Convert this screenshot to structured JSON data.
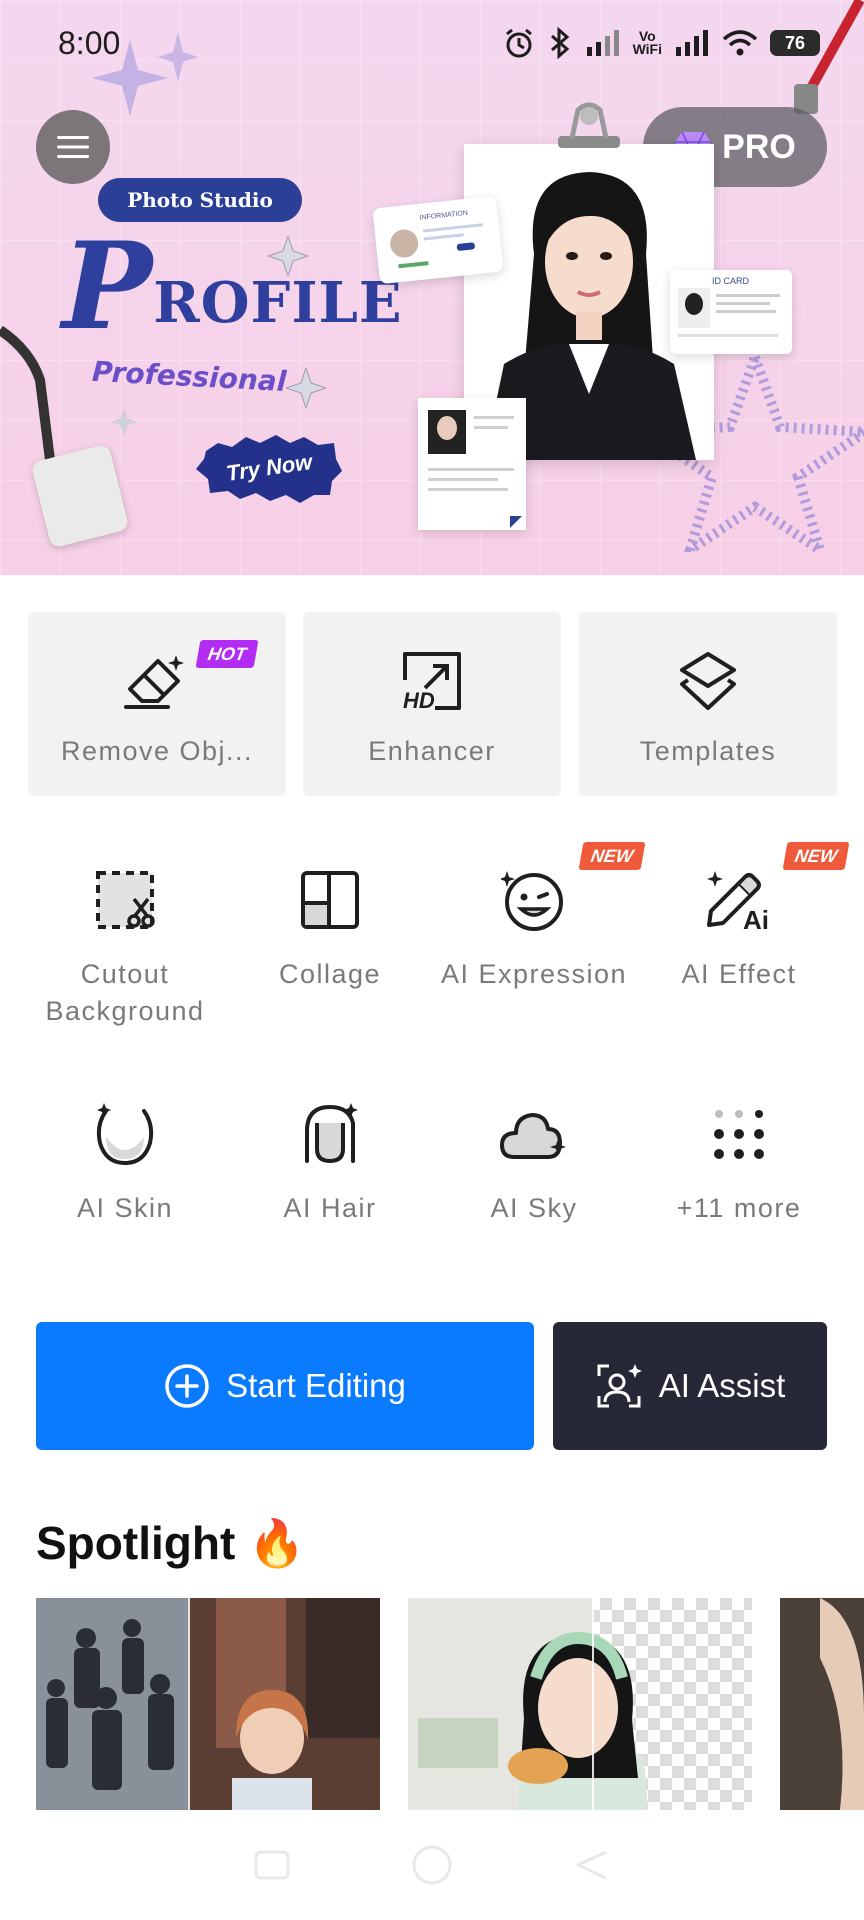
{
  "status_bar": {
    "time": "8:00",
    "vowifi_line1": "Vo",
    "vowifi_line2": "WiFi",
    "battery": "76"
  },
  "header": {
    "pro_label": "PRO"
  },
  "banner": {
    "photo_studio": "Photo Studio",
    "title_initial": "P",
    "title_rest": "ROFILE",
    "subtitle": "Professional",
    "cta": "Try Now",
    "info_card_text": "INFORMATION",
    "id_card_text": "ID CARD"
  },
  "quick_tools": [
    {
      "label": "Remove Obj...",
      "icon": "eraser-icon",
      "tag": "HOT"
    },
    {
      "label": "Enhancer",
      "icon": "hd-icon"
    },
    {
      "label": "Templates",
      "icon": "layers-icon"
    }
  ],
  "tools_grid": [
    {
      "label": "Cutout Background",
      "icon": "cutout-icon"
    },
    {
      "label": "Collage",
      "icon": "collage-icon"
    },
    {
      "label": "AI Expression",
      "icon": "wink-face-icon",
      "tag": "NEW"
    },
    {
      "label": "AI Effect",
      "icon": "magic-pen-icon",
      "tag": "NEW"
    },
    {
      "label": "AI Skin",
      "icon": "face-skin-icon"
    },
    {
      "label": "AI Hair",
      "icon": "hair-icon"
    },
    {
      "label": "AI Sky",
      "icon": "cloud-icon"
    },
    {
      "label": "+11 more",
      "icon": "grid-dots-icon"
    }
  ],
  "actions": {
    "start_editing": "Start Editing",
    "ai_assist": "AI Assist"
  },
  "spotlight": {
    "title": "Spotlight 🔥"
  },
  "colors": {
    "primary": "#0a7bff",
    "dark_button": "#262838",
    "hot_tag": "#b32cf2",
    "new_tag": "#ef5a3a",
    "label_gray": "#7a7a7a"
  }
}
